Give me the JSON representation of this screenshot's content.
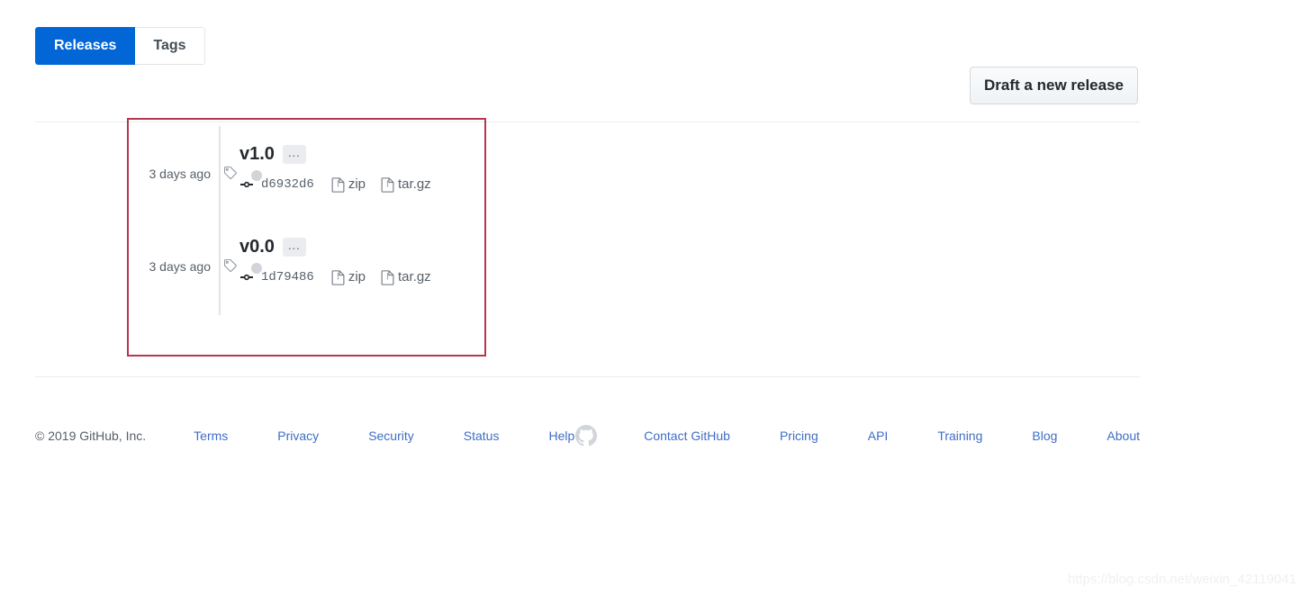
{
  "tabs": [
    {
      "label": "Releases",
      "active": true
    },
    {
      "label": "Tags",
      "active": false
    }
  ],
  "actions": {
    "draft_release_label": "Draft a new release"
  },
  "releases": [
    {
      "version": "v1.0",
      "menu_label": "...",
      "published": "3 days ago",
      "commit": "d6932d6",
      "assets": [
        {
          "label": "zip"
        },
        {
          "label": "tar.gz"
        }
      ]
    },
    {
      "version": "v0.0",
      "menu_label": "...",
      "published": "3 days ago",
      "commit": "1d79486",
      "assets": [
        {
          "label": "zip"
        },
        {
          "label": "tar.gz"
        }
      ]
    }
  ],
  "footer": {
    "copyright": "© 2019 GitHub, Inc.",
    "left_links": [
      "Terms",
      "Privacy",
      "Security",
      "Status",
      "Help"
    ],
    "right_links": [
      "Contact GitHub",
      "Pricing",
      "API",
      "Training",
      "Blog",
      "About"
    ]
  },
  "watermark": "https://blog.csdn.net/weixin_42119041",
  "colors": {
    "accent_blue": "#0366d6",
    "link_blue": "#3f6ec6",
    "annotation_red": "#b8364f",
    "muted_text": "#586069",
    "border": "#e1e4e8"
  }
}
